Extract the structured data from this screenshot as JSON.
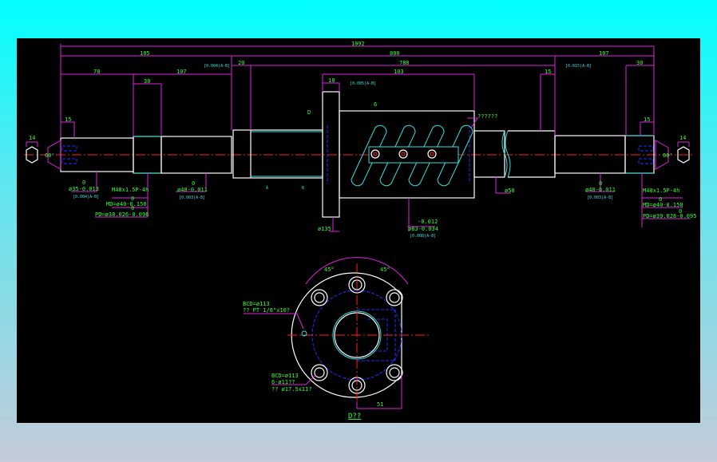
{
  "dims": {
    "total": "1092",
    "d185": "185",
    "d800": "800",
    "d107r": "107",
    "d20": "20",
    "d780": "780",
    "d78": "78",
    "d107l": "107",
    "d30l": "30",
    "d18": "18",
    "d103": "103",
    "d15l": "15",
    "d15m": "15",
    "d30r": "30",
    "d15r": "15",
    "d14l": "14",
    "d14r": "14",
    "a60l": "60'",
    "a60r": "60'"
  },
  "callouts": {
    "left_end": {
      "line1": "ø35-0.013",
      "sup": "0",
      "tol": "[0.004|A-B]"
    },
    "left_thread": {
      "line1": "M40x1.5P-4h",
      "line2": "MD=ø40-0.150",
      "line3": "PD=ø38.026-0.096",
      "sup": "0"
    },
    "left_bearing": {
      "line1": "ø40-0.011",
      "sup": "0",
      "tol": "[0.003|A-B]"
    },
    "right_bearing": {
      "line1": "ø40-0.011",
      "sup": "0",
      "tol": "[0.003|A-B]"
    },
    "right_thread": {
      "line1": "M40x1.5P-4h",
      "line2": "MD=ø40-0.150",
      "line3": "PD=ø39.028-0.095",
      "sup": "0"
    },
    "nut": {
      "line0": "-0.012",
      "line1": "ø83-0.034",
      "tol": "[0.008|A-B]"
    },
    "flange": "ø135",
    "shaft": "ø50",
    "note": "??????",
    "datum": "D",
    "roughness": "6"
  },
  "tol_tags": {
    "t1": "[0.004|A-B]",
    "t2": "[0.015|A-B]",
    "t3": "[0.005|A-B]"
  },
  "datum_tags": {
    "a": "A",
    "b": "B"
  },
  "section": {
    "angle_l": "45°",
    "angle_r": "45°",
    "bcd1": "BCD=ø113",
    "pt": "?? PT 1/8\"x10?",
    "bcd2": "BCD=ø113",
    "holes": "6-ø11??",
    "cbore": "?? ø17.5x11?",
    "dim51": "51",
    "title": "D??"
  }
}
